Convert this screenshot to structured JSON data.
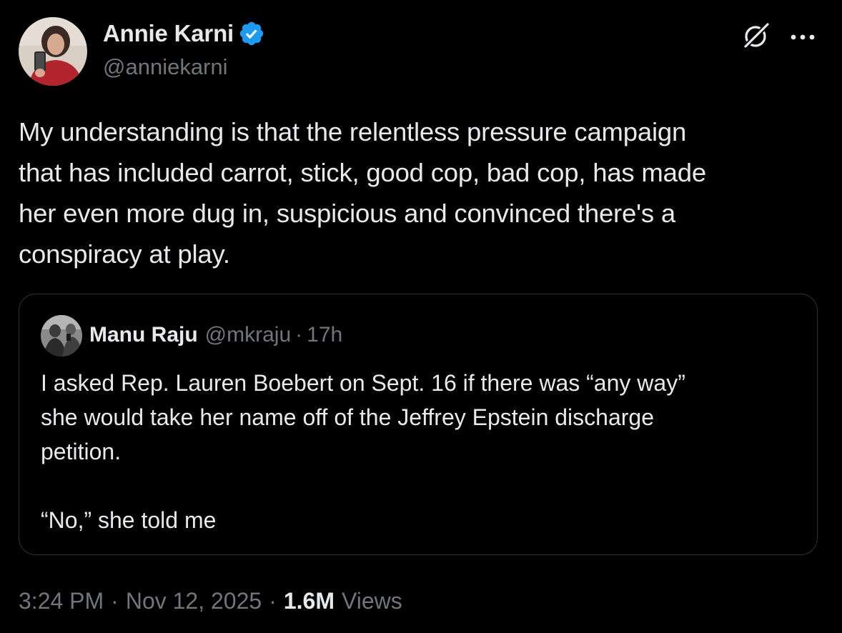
{
  "tweet": {
    "author": {
      "name": "Annie Karni",
      "handle": "@anniekarni",
      "verified": true
    },
    "text": "My understanding is that the relentless pressure campaign\nthat has included carrot, stick, good cop, bad cop, has made\nher even more dug in, suspicious and convinced there's a\nconspiracy at play.",
    "quoted": {
      "name": "Manu Raju",
      "handle": "@mkraju",
      "separator": "·",
      "time": "17h",
      "text": "I asked Rep. Lauren Boebert on Sept. 16 if there was “any way”\nshe would take her name off of the Jeffrey Epstein discharge\npetition.\n\n“No,” she told me"
    },
    "meta": {
      "time": "3:24 PM",
      "date": "Nov 12, 2025",
      "separator": "·",
      "views_count": "1.6M",
      "views_label": "Views"
    }
  },
  "icons": {
    "verified": "verified-badge-icon",
    "grok": "grok-icon",
    "more": "more-options-icon"
  },
  "colors": {
    "background": "#000000",
    "text_primary": "#e7e9ea",
    "text_secondary": "#71767b",
    "border": "#2f3336",
    "verified_blue": "#1d9bf0"
  }
}
